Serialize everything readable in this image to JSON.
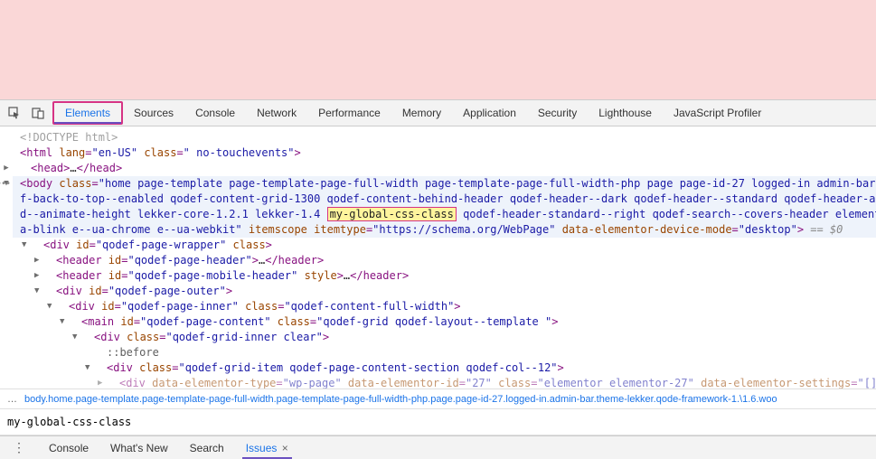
{
  "tabs": {
    "elements": "Elements",
    "sources": "Sources",
    "console": "Console",
    "network": "Network",
    "performance": "Performance",
    "memory": "Memory",
    "application": "Application",
    "security": "Security",
    "lighthouse": "Lighthouse",
    "profiler": "JavaScript Profiler"
  },
  "code": {
    "line1": "<!DOCTYPE html>",
    "line2_open": "<html ",
    "line2_attr1": "lang",
    "line2_val1": "\"en-US\"",
    "line2_attr2": "class",
    "line2_val2": "\" no-touchevents\"",
    "line2_close": ">",
    "line3_open": "<head>",
    "line3_dots": "…",
    "line3_close": "</head>",
    "body_open": "<body ",
    "body_attr_class": "class",
    "body_class_val": "\"home page-template page-template-page-full-width page-template-page-full-width-php page page-id-27 logged-in admin-bar theme-lekke",
    "body_class_line2a": "f-back-to-top--enabled qodef-content-grid-1300 qodef-content-behind-header qodef-header--dark qodef-header--standard qodef-header-appearance--sti",
    "body_class_line3a": "d--animate-height lekker-core-1.2.1 lekker-1.4 ",
    "body_class_hl": "my-global-css-class",
    "body_class_line3b": " qodef-header-standard--right qodef-search--covers-header elementor-default ele",
    "body_class_line4a": "a-blink e--ua-chrome e--ua-webkit\"",
    "body_attr_itemscope": "itemscope",
    "body_attr_itemtype": "itemtype",
    "body_itemtype_val": "\"https://schema.org/WebPage\"",
    "body_attr_dem": "data-elementor-device-mode",
    "body_dem_val": "\"desktop\"",
    "body_close": ">",
    "body_eq0": " == $0",
    "div_wrapper": "<div id=\"qodef-page-wrapper\" class>",
    "header1": "<header id=\"qodef-page-header\">…</header>",
    "header2": "<header id=\"qodef-page-mobile-header\" style>…</header>",
    "div_outer": "<div id=\"qodef-page-outer\">",
    "div_inner": "<div id=\"qodef-page-inner\" class=\"qodef-content-full-width\">",
    "main": "<main id=\"qodef-page-content\" class=\"qodef-grid qodef-layout--template \">",
    "div_grid_inner": "<div class=\"qodef-grid-inner clear\">",
    "before": "::before",
    "div_grid_item": "<div class=\"qodef-grid-item qodef-page-content-section qodef-col--12\">",
    "div_elementor": "<div data-elementor-type=\"wp-page\" data-elementor-id=\"27\" class=\"elementor elementor-27\" data-elementor-settings=\"[]\">"
  },
  "breadcrumb": {
    "seg1": "body.home.page-template.page-template-page-full-width.page-template-page-full-width-php.page.page-id-27.logged-in.admin-bar.theme-lekker.qode-framework-1.\\1.6.woo"
  },
  "search": {
    "value": "my-global-css-class"
  },
  "drawer": {
    "console": "Console",
    "whatsnew": "What's New",
    "search": "Search",
    "issues": "Issues"
  }
}
